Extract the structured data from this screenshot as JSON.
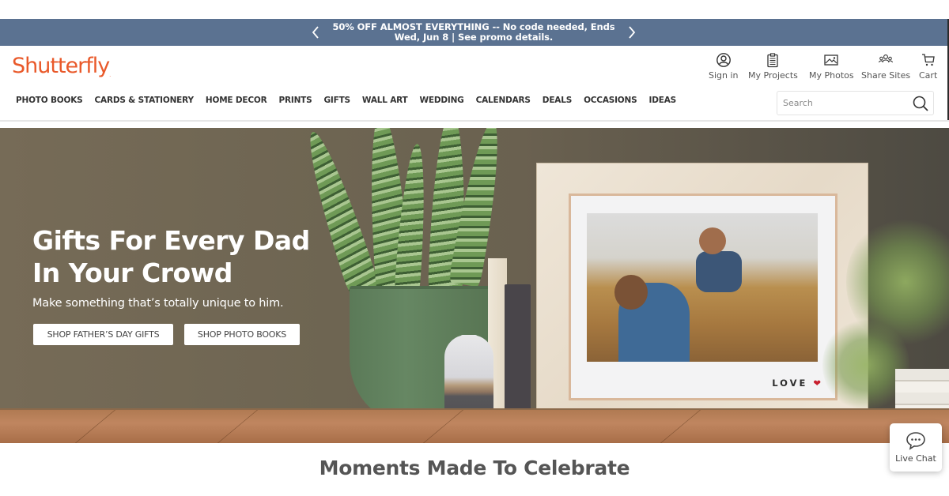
{
  "promo": {
    "text": "50% OFF ALMOST EVERYTHING -- No code needed, Ends Wed, Jun 8 | See promo details.",
    "prev_icon": "chevron-left-icon",
    "next_icon": "chevron-right-icon",
    "background": "#5b7291"
  },
  "header": {
    "logo": "Shutterfly",
    "brand_color": "#e9592a",
    "utilities": [
      {
        "label": "Sign in",
        "icon": "user-circle-icon"
      },
      {
        "label": "My Projects",
        "icon": "clipboard-icon"
      },
      {
        "label": "My Photos",
        "icon": "image-icon"
      },
      {
        "label": "Share Sites",
        "icon": "group-icon"
      },
      {
        "label": "Cart",
        "icon": "cart-icon"
      }
    ]
  },
  "nav": {
    "items": [
      "PHOTO BOOKS",
      "CARDS & STATIONERY",
      "HOME DECOR",
      "PRINTS",
      "GIFTS",
      "WALL ART",
      "WEDDING",
      "CALENDARS",
      "DEALS",
      "OCCASIONS",
      "IDEAS"
    ]
  },
  "search": {
    "placeholder": "Search",
    "value": "",
    "icon": "search-icon"
  },
  "hero": {
    "title_line1": "Gifts For Every Dad",
    "title_line2": "In Your Crowd",
    "subtitle": "Make something that’s totally unique to him.",
    "buttons": [
      "SHOP FATHER’S DAY GIFTS",
      "SHOP PHOTO BOOKS"
    ],
    "frame_caption": "LOVE",
    "frame_caption_icon": "heart-icon"
  },
  "live_chat": {
    "label": "Live Chat",
    "icon": "chat-bubble-icon"
  },
  "section": {
    "title": "Moments Made To Celebrate"
  }
}
